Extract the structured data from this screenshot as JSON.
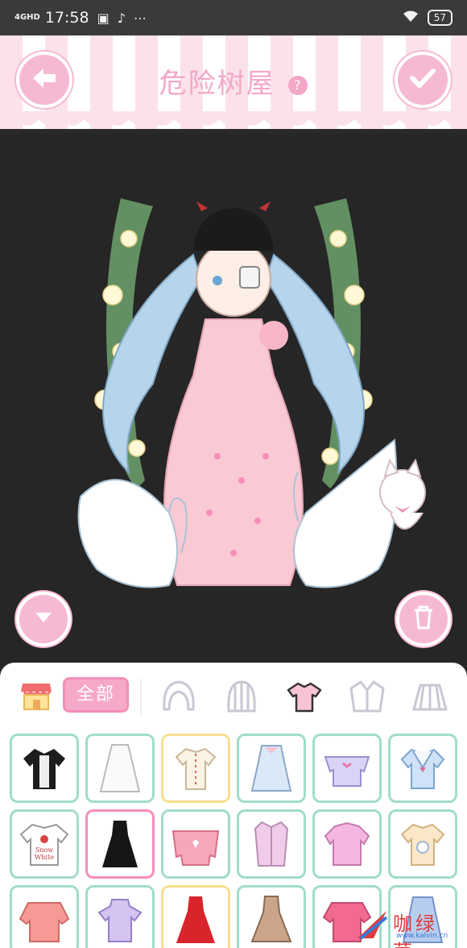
{
  "status_bar": {
    "network": "4GHD",
    "time": "17:58",
    "battery": "57",
    "icons": [
      "sim-icon",
      "tiktok-icon",
      "more-icon",
      "wifi-icon"
    ]
  },
  "header": {
    "title": "危险树屋",
    "help_label": "?",
    "back_icon": "arrow-left-icon",
    "confirm_icon": "check-icon"
  },
  "stage": {
    "down_icon": "chevron-down-icon",
    "trash_icon": "trash-icon"
  },
  "panel": {
    "filter_label": "全部",
    "categories": [
      "shop-icon",
      "hair-front-icon",
      "hair-back-icon",
      "top-icon",
      "jacket-icon",
      "skirt-icon"
    ],
    "items": [
      {
        "name": "black-lace-blouse",
        "frame": "green"
      },
      {
        "name": "white-dress",
        "frame": "green"
      },
      {
        "name": "cream-blouse",
        "frame": "yellow"
      },
      {
        "name": "pastel-dress",
        "frame": "green"
      },
      {
        "name": "lavender-offshoulder",
        "frame": "green"
      },
      {
        "name": "sailor-top",
        "frame": "green"
      },
      {
        "name": "snow-white-tee",
        "frame": "green"
      },
      {
        "name": "black-slip-dress",
        "frame": "pink"
      },
      {
        "name": "pink-sweater",
        "frame": "green"
      },
      {
        "name": "pink-shirt",
        "frame": "green"
      },
      {
        "name": "pink-hoodie",
        "frame": "green"
      },
      {
        "name": "bunny-tee",
        "frame": "green"
      },
      {
        "name": "coral-knit",
        "frame": "green"
      },
      {
        "name": "lilac-tee",
        "frame": "green"
      },
      {
        "name": "red-dress",
        "frame": "yellow"
      },
      {
        "name": "tan-dress",
        "frame": "green"
      },
      {
        "name": "pink-sweater-2",
        "frame": "green"
      },
      {
        "name": "blue-dress",
        "frame": "green"
      }
    ],
    "snow_white_text_1": "Snow",
    "snow_white_text_2": "White"
  },
  "watermark": {
    "text": "咖绿茵",
    "url": "www.kalvin.cn"
  }
}
